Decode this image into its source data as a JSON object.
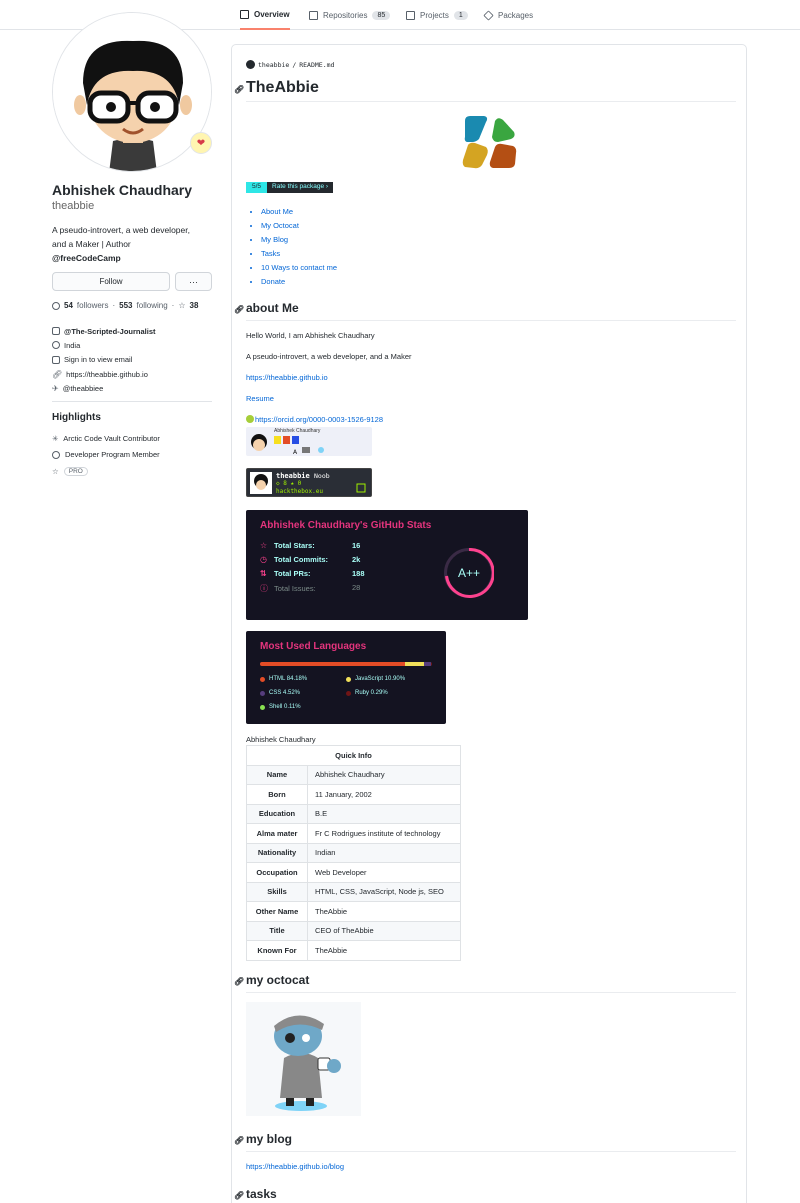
{
  "tabs": [
    {
      "label": "Overview",
      "count": null,
      "active": true
    },
    {
      "label": "Repositories",
      "count": "85",
      "active": false
    },
    {
      "label": "Projects",
      "count": "1",
      "active": false
    },
    {
      "label": "Packages",
      "count": null,
      "active": false
    }
  ],
  "profile": {
    "full_name": "Abhishek Chaudhary",
    "username": "theabbie",
    "bio_line1": "A pseudo-introvert, a web developer,",
    "bio_line2": "and a Maker | Author",
    "bio_org": "@freeCodeCamp",
    "follow_label": "Follow",
    "more_label": "···",
    "followers_count": "54",
    "followers_label": "followers",
    "following_count": "553",
    "following_label": "following",
    "stars_count": "38",
    "dot": "·",
    "organization": "@The-Scripted-Journalist",
    "location": "India",
    "email": "Sign in to view email",
    "website": "https://theabbie.github.io",
    "twitter": "@theabbiee"
  },
  "highlights": {
    "title": "Highlights",
    "items": [
      "Arctic Code Vault Contributor",
      "Developer Program Member"
    ],
    "pro": "PRO"
  },
  "readme": {
    "crumb_user": "theabbie",
    "crumb_sep": "/",
    "crumb_file": "README.md",
    "title": "TheAbbie",
    "rate_left": "5/5",
    "rate_right": "Rate this package ›",
    "toc": [
      "About Me",
      "My Octocat",
      "My Blog",
      "Tasks",
      "10 Ways to contact me",
      "Donate"
    ],
    "about_heading": "about Me",
    "about_p1": "Hello World, I am Abhishek Chaudhary",
    "about_p2": "A pseudo-introvert, a web developer, and a Maker",
    "about_link": "https://theabbie.github.io",
    "resume": "Resume",
    "orcid": "https://orcid.org/0000-0003-1526-9128",
    "mini_card_name": "Abhishek Chaudhary",
    "thm_user": "theabbie",
    "thm_rank": "Noob",
    "thm_stats": "◇ 8  ★ 0",
    "thm_site": "hackthebox.eu",
    "octocat_heading": "my octocat",
    "blog_heading": "my blog",
    "blog_link": "https://theabbie.github.io/blog",
    "tasks_heading": "tasks"
  },
  "github_stats": {
    "title": "Abhishek Chaudhary's GitHub Stats",
    "rows": [
      {
        "label": "Total Stars:",
        "value": "16"
      },
      {
        "label": "Total Commits:",
        "value": "2k"
      },
      {
        "label": "Total PRs:",
        "value": "188"
      },
      {
        "label": "Total Issues:",
        "value": "28"
      }
    ],
    "grade": "A++",
    "accent": "#e4347d",
    "text_color": "#a9fef7",
    "background": "#141321"
  },
  "languages": {
    "title": "Most Used Languages",
    "items": [
      {
        "label": "HTML 84.18%",
        "percent": 84.18,
        "color": "#e34c26"
      },
      {
        "label": "JavaScript 10.90%",
        "percent": 10.9,
        "color": "#f1e05a"
      },
      {
        "label": "CSS 4.52%",
        "percent": 4.52,
        "color": "#563d7c"
      },
      {
        "label": "Ruby 0.29%",
        "percent": 0.29,
        "color": "#701516"
      },
      {
        "label": "Shell 0.11%",
        "percent": 0.11,
        "color": "#89e051"
      }
    ]
  },
  "quick_info": {
    "caption": "Abhishek Chaudhary",
    "header": "Quick Info",
    "rows": [
      {
        "k": "Name",
        "v": "Abhishek Chaudhary"
      },
      {
        "k": "Born",
        "v": "11 January, 2002"
      },
      {
        "k": "Education",
        "v": "B.E"
      },
      {
        "k": "Alma mater",
        "v": "Fr C Rodrigues institute of technology"
      },
      {
        "k": "Nationality",
        "v": "Indian"
      },
      {
        "k": "Occupation",
        "v": "Web Developer"
      },
      {
        "k": "Skills",
        "v": "HTML, CSS, JavaScript, Node js, SEO"
      },
      {
        "k": "Other Name",
        "v": "TheAbbie"
      },
      {
        "k": "Title",
        "v": "CEO of TheAbbie"
      },
      {
        "k": "Known For",
        "v": "TheAbbie"
      }
    ]
  }
}
